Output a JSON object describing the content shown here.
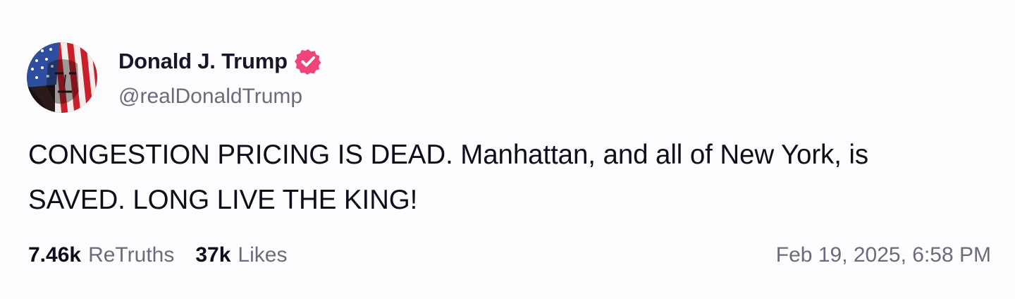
{
  "author": {
    "display_name": "Donald J. Trump",
    "handle": "@realDonaldTrump",
    "verified_icon": "verified-badge-icon",
    "avatar_icon": "flag-portrait-avatar"
  },
  "post": {
    "text_lines": [
      "CONGESTION PRICING IS DEAD. Manhattan, and all of New York, is",
      "SAVED. LONG LIVE THE KING!"
    ]
  },
  "stats": {
    "retruths_count": "7.46k",
    "retruths_label": "ReTruths",
    "likes_count": "37k",
    "likes_label": "Likes"
  },
  "timestamp": "Feb 19, 2025, 6:58 PM",
  "colors": {
    "background": "#fdfcfe",
    "text_primary": "#0f0d1c",
    "text_secondary": "#6d6a7c",
    "verified_badge": "#f0457a"
  }
}
